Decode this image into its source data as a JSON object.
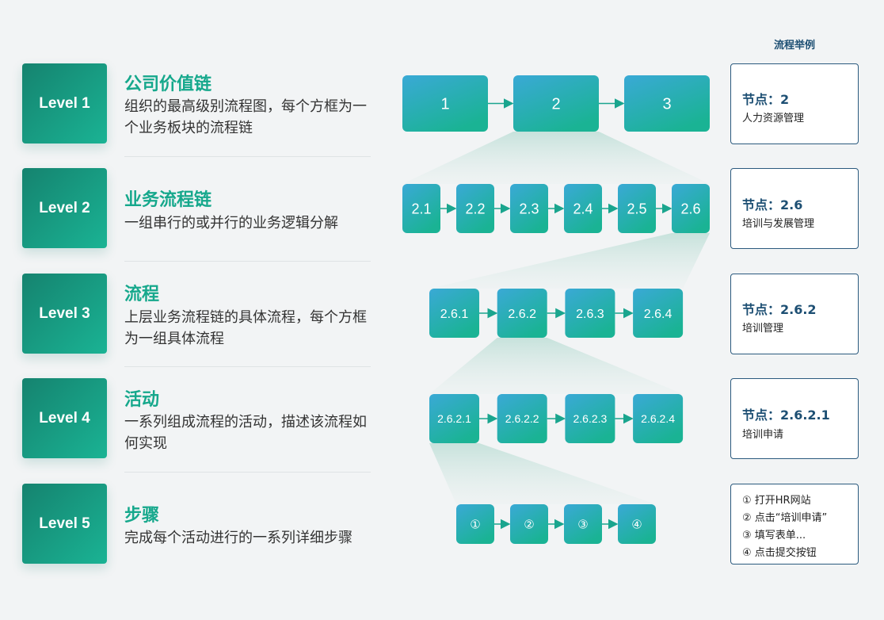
{
  "header": "流程举例",
  "levels": [
    {
      "badge": "Level 1",
      "title": "公司价值链",
      "desc": "组织的最高级别流程图，每个方框为一个业务板块的流程链"
    },
    {
      "badge": "Level 2",
      "title": "业务流程链",
      "desc": "一组串行的或并行的业务逻辑分解"
    },
    {
      "badge": "Level 3",
      "title": "流程",
      "desc": "上层业务流程链的具体流程，每个方框为一组具体流程"
    },
    {
      "badge": "Level 4",
      "title": "活动",
      "desc": "一系列组成流程的活动，描述该流程如何实现"
    },
    {
      "badge": "Level 5",
      "title": "步骤",
      "desc": "完成每个活动进行的一系列详细步骤"
    }
  ],
  "chains": [
    [
      "1",
      "2",
      "3"
    ],
    [
      "2.1",
      "2.2",
      "2.3",
      "2.4",
      "2.5",
      "2.6"
    ],
    [
      "2.6.1",
      "2.6.2",
      "2.6.3",
      "2.6.4"
    ],
    [
      "2.6.2.1",
      "2.6.2.2",
      "2.6.2.3",
      "2.6.2.4"
    ],
    [
      "①",
      "②",
      "③",
      "④"
    ]
  ],
  "examples": [
    {
      "head": "节点：2",
      "sub": "人力资源管理"
    },
    {
      "head": "节点：2.6",
      "sub": "培训与发展管理"
    },
    {
      "head": "节点：2.6.2",
      "sub": "培训管理"
    },
    {
      "head": "节点：2.6.2.1",
      "sub": "培训申请"
    }
  ],
  "steps": [
    "① 打开HR网站",
    "② 点击“培训申请”",
    "③ 填写表单...",
    "④ 点击提交按钮"
  ],
  "colors": {
    "accent": "#16a88c",
    "node_top": "#3aa9d6",
    "node_bottom": "#1ab394",
    "example_border": "#2b5a7e",
    "example_text": "#1d4f73"
  }
}
